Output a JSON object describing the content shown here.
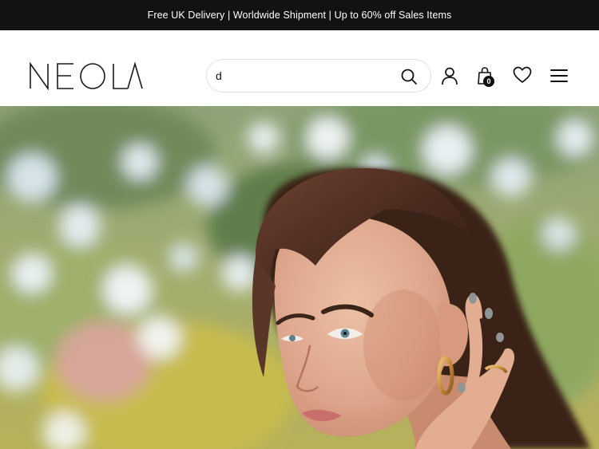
{
  "announcement": {
    "text": "Free UK Delivery | Worldwide Shipment | Up to 60% off Sales Items"
  },
  "header": {
    "logo_text": "NEOLA",
    "search": {
      "value": "d",
      "placeholder": ""
    },
    "icons": {
      "search": "search-icon",
      "account": "user-icon",
      "cart": "shopping-bag-icon",
      "wishlist": "heart-icon",
      "menu": "hamburger-menu-icon"
    },
    "cart_count": "0"
  },
  "hero": {
    "image": "woman-with-gold-hoop-earrings-photo"
  },
  "colors": {
    "announcement_bg": "#121212",
    "text": "#111111",
    "background": "#ffffff"
  }
}
